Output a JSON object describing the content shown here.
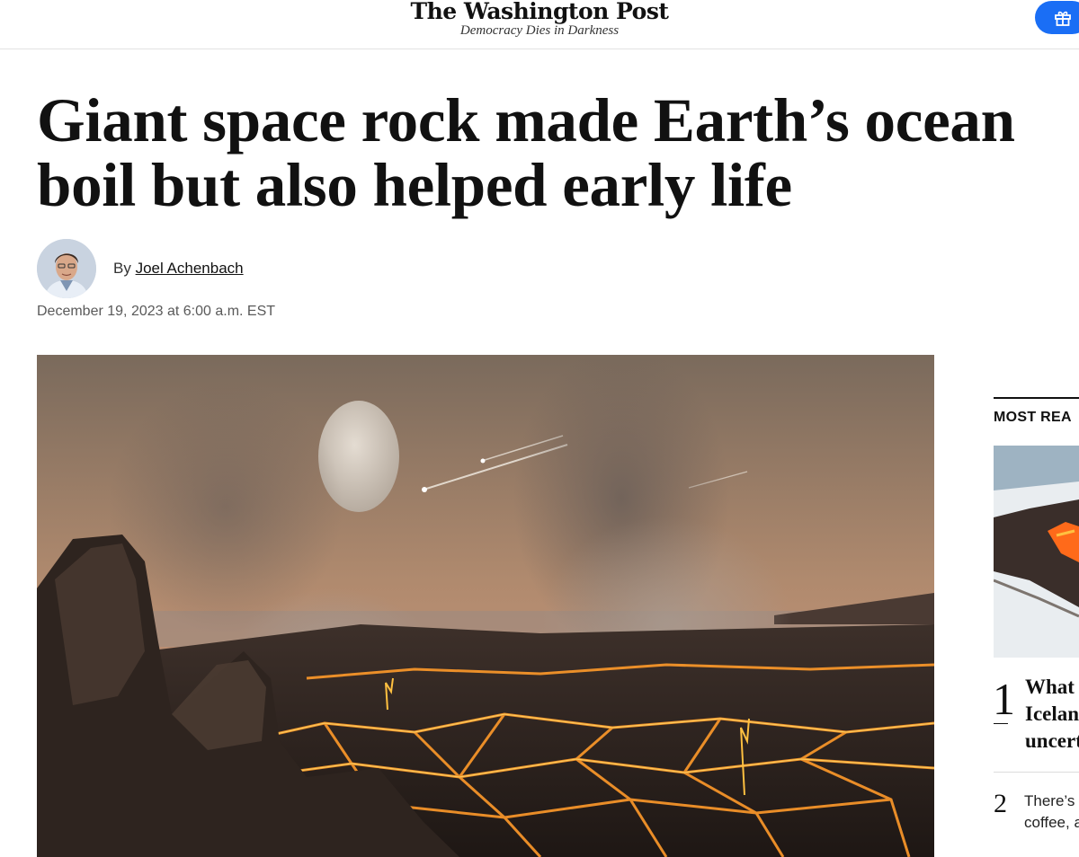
{
  "header": {
    "logo": "The Washington Post",
    "tagline": "Democracy Dies in Darkness",
    "gift_icon": "gift-icon",
    "accent_color": "#1a6ef5"
  },
  "article": {
    "headline": "Giant space rock made Earth’s ocean boil but also helped early life",
    "byline_prefix": "By",
    "author": "Joel Achenbach",
    "date": "December 19, 2023 at 6:00 a.m. EST"
  },
  "right_rail": {
    "heading": "MOST REA",
    "items": [
      {
        "number": "1",
        "lines": [
          "What",
          "Icelan",
          "uncert"
        ]
      },
      {
        "number": "2",
        "lines": [
          "There’s",
          "coffee, a"
        ]
      }
    ]
  }
}
